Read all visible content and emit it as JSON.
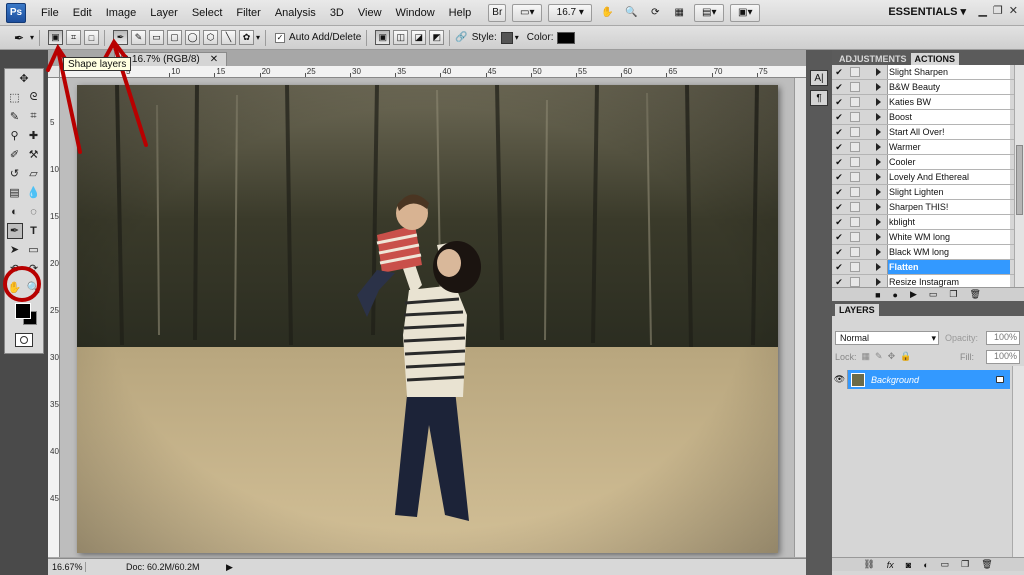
{
  "menubar": {
    "logo": "Ps",
    "items": [
      "File",
      "Edit",
      "Image",
      "Layer",
      "Select",
      "Filter",
      "Analysis",
      "3D",
      "View",
      "Window",
      "Help"
    ],
    "bridge_label": "Br",
    "zoom_value": "16.7",
    "workspace": "ESSENTIALS"
  },
  "options_bar": {
    "auto_add_delete": "Auto Add/Delete",
    "style_label": "Style:",
    "color_label": "Color:",
    "color_value": "#000000"
  },
  "tooltip": "Shape layers",
  "document": {
    "tab_label": "@ 16.7% (RGB/8)",
    "ruler_ticks_top": [
      "5",
      "10",
      "15",
      "20",
      "25",
      "30",
      "35",
      "40",
      "45",
      "50",
      "55",
      "60",
      "65",
      "70",
      "75"
    ],
    "ruler_ticks_left": [
      "5",
      "10",
      "15",
      "20",
      "25",
      "30",
      "35",
      "40",
      "45"
    ],
    "status_zoom": "16.67%",
    "status_doc": "Doc: 60.2M/60.2M"
  },
  "actions_panel": {
    "tabs": [
      "ADJUSTMENTS",
      "ACTIONS"
    ],
    "items": [
      {
        "name": "Slight Sharpen",
        "highlighted": false
      },
      {
        "name": "B&W Beauty",
        "highlighted": false
      },
      {
        "name": "Katies BW",
        "highlighted": false
      },
      {
        "name": "Boost",
        "highlighted": false
      },
      {
        "name": "Start All Over!",
        "highlighted": false
      },
      {
        "name": "Warmer",
        "highlighted": false
      },
      {
        "name": "Cooler",
        "highlighted": false
      },
      {
        "name": "Lovely And Ethereal",
        "highlighted": false
      },
      {
        "name": "Slight Lighten",
        "highlighted": false
      },
      {
        "name": "Sharpen THIS!",
        "highlighted": false
      },
      {
        "name": "kblight",
        "highlighted": false
      },
      {
        "name": "White WM long",
        "highlighted": false
      },
      {
        "name": "Black WM long",
        "highlighted": false
      },
      {
        "name": "Flatten",
        "highlighted": true
      },
      {
        "name": "Resize Instagram",
        "highlighted": false
      }
    ]
  },
  "layers_panel": {
    "tab": "LAYERS",
    "blend_mode": "Normal",
    "opacity_label": "Opacity:",
    "opacity_value": "100%",
    "lock_label": "Lock:",
    "fill_label": "Fill:",
    "fill_value": "100%",
    "layers": [
      {
        "name": "Background"
      }
    ]
  },
  "colors": {
    "highlight": "#3399ff",
    "annotation_red": "#b80000"
  }
}
